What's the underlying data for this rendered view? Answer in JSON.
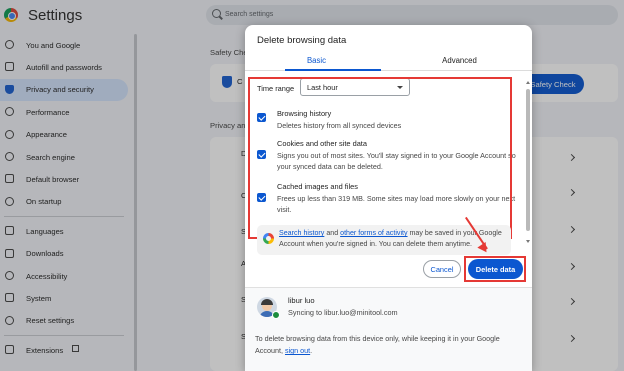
{
  "app": {
    "title": "Settings",
    "search_placeholder": "Search settings"
  },
  "sidebar": {
    "items": [
      {
        "label": "You and Google",
        "icon": "google-icon"
      },
      {
        "label": "Autofill and passwords",
        "icon": "key-icon"
      },
      {
        "label": "Privacy and security",
        "icon": "shield-icon",
        "active": true
      },
      {
        "label": "Performance",
        "icon": "speedometer-icon"
      },
      {
        "label": "Appearance",
        "icon": "palette-icon"
      },
      {
        "label": "Search engine",
        "icon": "search-icon"
      },
      {
        "label": "Default browser",
        "icon": "browser-icon"
      },
      {
        "label": "On startup",
        "icon": "power-icon"
      },
      {
        "label": "Languages",
        "icon": "translate-icon"
      },
      {
        "label": "Downloads",
        "icon": "download-icon"
      },
      {
        "label": "Accessibility",
        "icon": "accessibility-icon"
      },
      {
        "label": "System",
        "icon": "wrench-icon"
      },
      {
        "label": "Reset settings",
        "icon": "reset-icon"
      },
      {
        "label": "Extensions",
        "icon": "puzzle-icon"
      }
    ]
  },
  "main": {
    "safety_label": "Safety Che",
    "safety_button": "Safety Check",
    "privacy_label": "Privacy an",
    "row_letters": [
      "C",
      "D",
      "C",
      "S",
      "A",
      "S",
      "S",
      "S"
    ]
  },
  "dialog": {
    "title": "Delete browsing data",
    "tabs": [
      "Basic",
      "Advanced"
    ],
    "time_range_label": "Time range",
    "time_range_value": "Last hour",
    "options": [
      {
        "title": "Browsing history",
        "desc": "Deletes history from all synced devices",
        "checked": true
      },
      {
        "title": "Cookies and other site data",
        "desc": "Signs you out of most sites. You'll stay signed in to your Google Account so your synced data can be deleted.",
        "checked": true
      },
      {
        "title": "Cached images and files",
        "desc": "Frees up less than 319 MB. Some sites may load more slowly on your next visit.",
        "checked": true
      }
    ],
    "info": {
      "link1": "Search history",
      "mid1": " and ",
      "link2": "other forms of activity",
      "rest": " may be saved in your Google Account when you're signed in. You can delete them anytime."
    },
    "cancel": "Cancel",
    "delete": "Delete data",
    "account": {
      "name": "libur luo",
      "sync": "Syncing to libur.luo@minitool.com",
      "note_pre": "To delete browsing data from this device only, while keeping it in your Google Account, ",
      "note_link": "sign out",
      "note_post": "."
    }
  },
  "colors": {
    "accent": "#0b57d0",
    "highlight": "#e53935",
    "active_nav": "#d3e3fd"
  }
}
